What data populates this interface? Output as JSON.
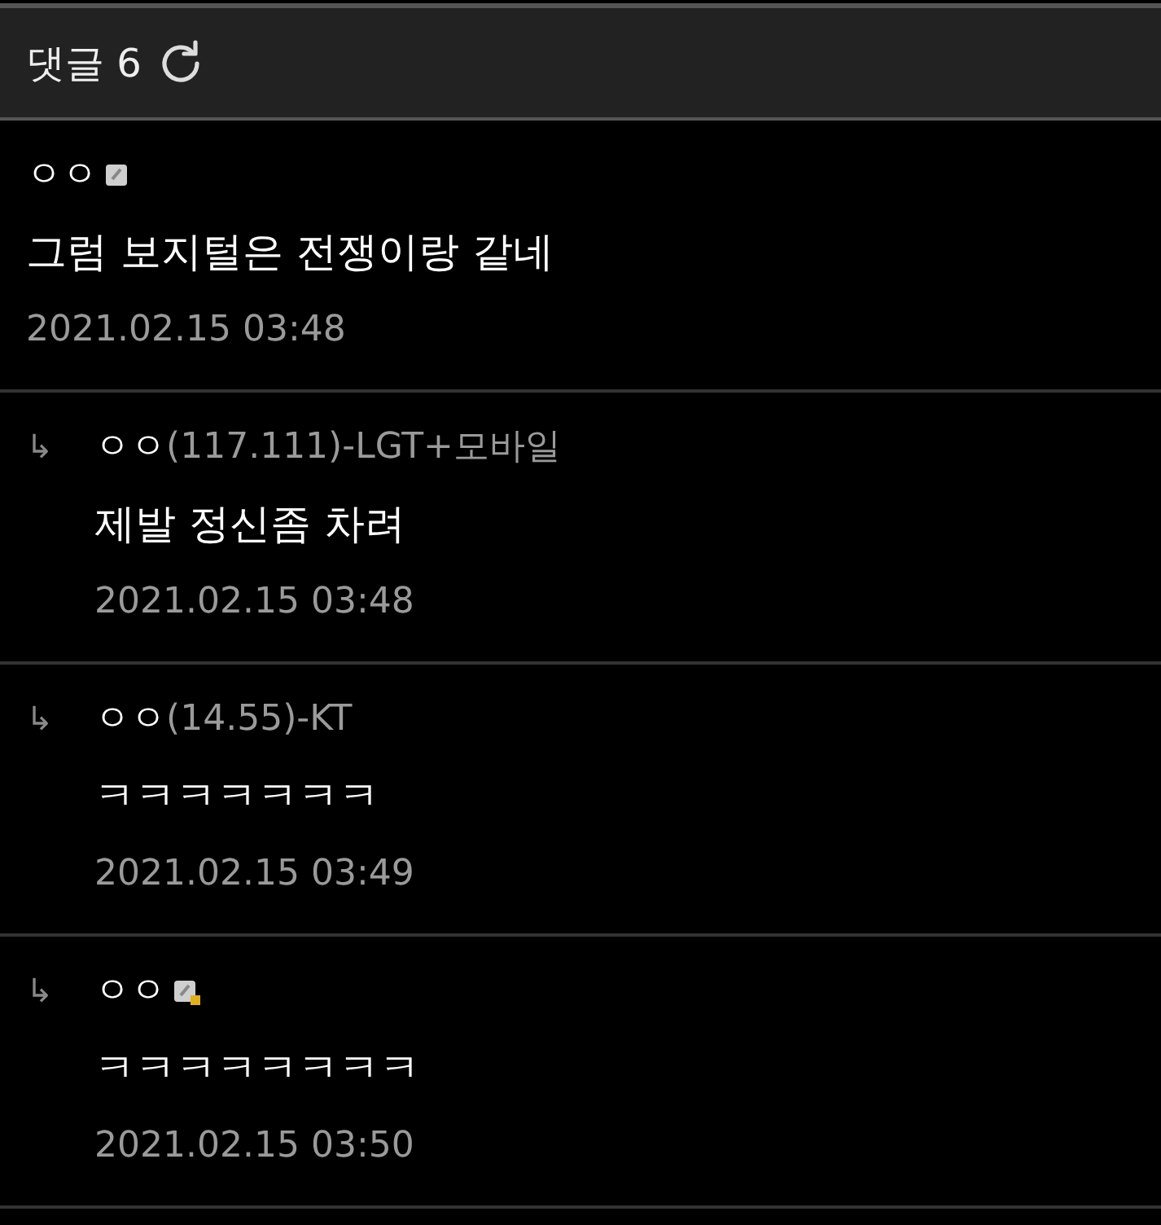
{
  "header": {
    "title": "댓글 6"
  },
  "comments": [
    {
      "kind": "comment",
      "nick": "ㅇㅇ",
      "badge": {
        "kind": "full"
      },
      "body": "그럼 보지털은 전쟁이랑 같네",
      "date": "2021.02.15 03:48"
    },
    {
      "kind": "reply",
      "arrow": "↳",
      "nick": "ㅇㅇ",
      "ip": "(117.111)-LGT+모바일",
      "body": "제발 정신좀 차려",
      "date": "2021.02.15 03:48"
    },
    {
      "kind": "reply",
      "arrow": "↳",
      "nick": "ㅇㅇ",
      "ip": "(14.55)-KT",
      "body": "ㅋㅋㅋㅋㅋㅋㅋ",
      "date": "2021.02.15 03:49"
    },
    {
      "kind": "reply",
      "arrow": "↳",
      "nick": "ㅇㅇ",
      "badge": {
        "kind": "half"
      },
      "body": "ㅋㅋㅋㅋㅋㅋㅋㅋ",
      "date": "2021.02.15 03:50"
    }
  ]
}
